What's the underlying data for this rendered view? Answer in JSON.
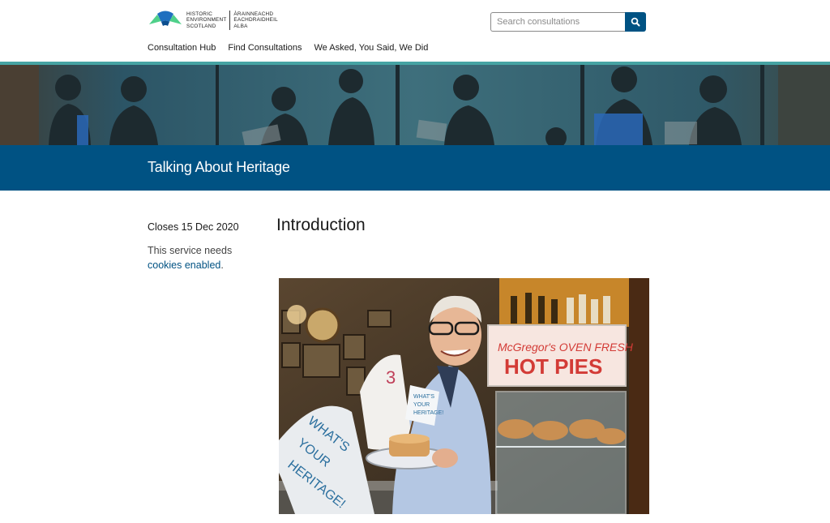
{
  "brand": {
    "name_en": [
      "HISTORIC",
      "ENVIRONMENT",
      "SCOTLAND"
    ],
    "name_gd": [
      "ÀRAINNEACHD",
      "EACHDRAIDHEIL",
      "ALBA"
    ],
    "colors": {
      "primary": "#005283",
      "accent_teal": "#46a3a3",
      "logo_green": "#4fd08a",
      "logo_blue": "#1f6fbf"
    }
  },
  "search": {
    "placeholder": "Search consultations",
    "button_icon": "search-icon"
  },
  "nav": {
    "items": [
      "Consultation Hub",
      "Find Consultations",
      "We Asked, You Said, We Did"
    ]
  },
  "page": {
    "title": "Talking About Heritage"
  },
  "sidebar": {
    "closes": "Closes 15 Dec 2020",
    "cookie_text": "This service needs",
    "cookie_link": "cookies enabled",
    "cookie_suffix": "."
  },
  "main": {
    "heading": "Introduction",
    "photo": {
      "tea_towel_text": [
        "WHAT'S",
        "YOUR",
        "HERITAGE!"
      ],
      "flag_text": [
        "WHAT'S",
        "YOUR",
        "HERITAGE!"
      ],
      "sign_top": "McGregor's OVEN FRESH",
      "sign_main": "HOT PIES",
      "towel_number": "3"
    }
  }
}
